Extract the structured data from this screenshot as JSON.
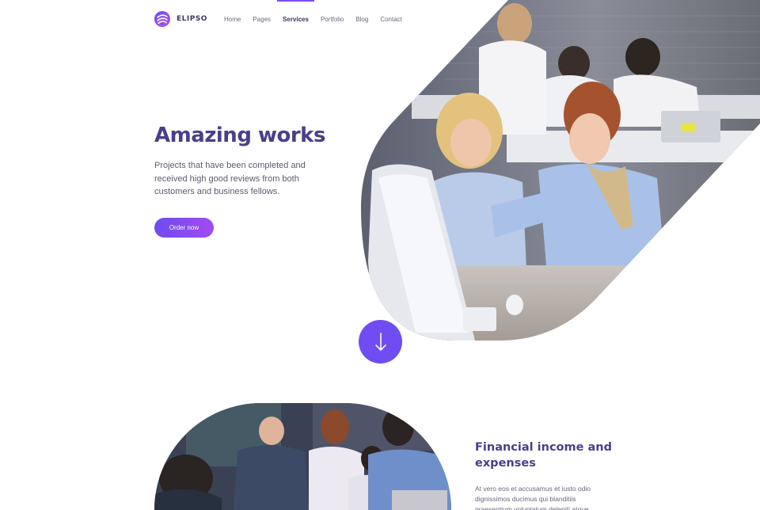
{
  "brand": {
    "name": "ELIPSO",
    "accent": "#7c4dff",
    "title_color": "#4a3f8a"
  },
  "nav": {
    "items": [
      {
        "label": "Home"
      },
      {
        "label": "Pages"
      },
      {
        "label": "Services",
        "active": true
      },
      {
        "label": "Portfolio"
      },
      {
        "label": "Blog"
      },
      {
        "label": "Contact"
      }
    ]
  },
  "hero": {
    "title": "Amazing works",
    "text": "Projects that have been completed and received high good reviews from both customers and business fellows.",
    "button_label": "Order now",
    "image": "office-team-at-computer-photo"
  },
  "scroll": {
    "icon": "arrow-down-icon"
  },
  "feature": {
    "image": "business-team-meeting-photo",
    "title": "Financial income and expenses",
    "text": "At vero eos et accusamus et iusto odio dignissimos ducimus qui blanditiis praesentium voluptatum deleniti atque"
  }
}
